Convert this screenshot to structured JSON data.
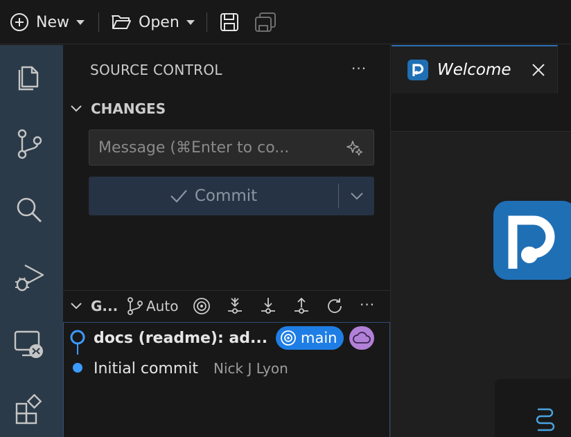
{
  "toolbar": {
    "new_label": "New",
    "open_label": "Open"
  },
  "sidebar": {
    "title": "SOURCE CONTROL",
    "more": "···",
    "changes_header": "CHANGES",
    "message_placeholder": "Message (⌘Enter to co...",
    "commit_label": "Commit"
  },
  "graph": {
    "title": "G...",
    "auto_label": "Auto",
    "commits": [
      {
        "message": "docs (readme): ad...",
        "branch": "main"
      },
      {
        "message": "Initial commit",
        "author": "Nick J Lyon"
      }
    ]
  },
  "editor": {
    "tab_label": "Welcome"
  },
  "colors": {
    "activity_bar": "#2b3a48",
    "branch_badge": "#1f7ee5",
    "cloud_badge": "#b180d7",
    "commit_button": "#253344",
    "logo_blue": "#1f6fb5"
  }
}
